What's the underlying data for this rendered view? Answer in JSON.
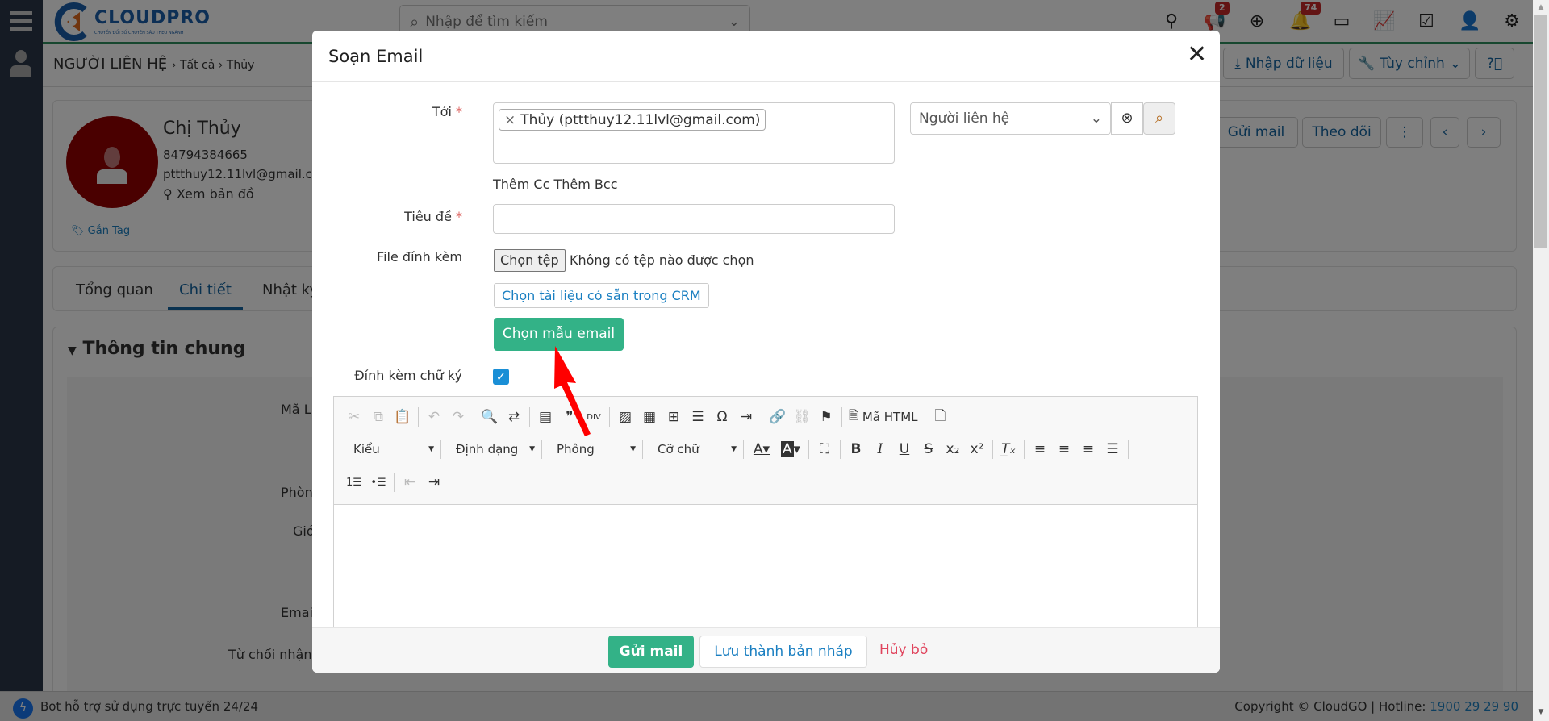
{
  "topbar": {
    "logo_text": "CLOUDPRO",
    "logo_tagline": "CHUYỂN ĐỔI SỐ CHUYÊN SÂU THEO NGÀNH",
    "search_placeholder": "Nhập để tìm kiếm",
    "icons": [
      "location-icon",
      "megaphone-icon",
      "plus-circle-icon",
      "bell-icon",
      "calendar-icon",
      "chart-icon",
      "checkbox-icon",
      "user-icon",
      "gear-icon"
    ],
    "announcement_badge": "2",
    "notification_badge": "74"
  },
  "breadcrumb": {
    "module": "NGƯỜI LIÊN HỆ",
    "filter": "Tất cả",
    "record": "Thủy"
  },
  "header_actions": {
    "import": "Nhập dữ liệu",
    "customize": "Tùy chỉnh"
  },
  "contact": {
    "name": "Chị Thủy",
    "phone": "84794384665",
    "email": "pttthuy12.11lvl@gmail.com",
    "map": "Xem bản đồ",
    "tag": "Gắn Tag",
    "avatar_color": "#950000",
    "actions": {
      "send_mail": "Gửi mail",
      "follow": "Theo dõi"
    }
  },
  "tabs": [
    "Tổng quan",
    "Chi tiết",
    "Nhật ký"
  ],
  "active_tab": "Chi tiết",
  "section": {
    "title": "Thông tin chung",
    "labels": [
      "Mã Li",
      "Phòng",
      "Giớ",
      "Email",
      "Từ chối nhận"
    ]
  },
  "footer": {
    "bot": "Bot hỗ trợ sử dụng trực tuyến 24/24",
    "copyright": "Copyright © CloudGO",
    "hotline_label": "Hotline:",
    "hotline": "1900 29 29 90"
  },
  "modal": {
    "title": "Soạn Email",
    "to_label": "Tới",
    "recipient_tag": "Thủy (pttthuy12.11lvl@gmail.com)",
    "recipient_type": "Người liên hệ",
    "add_cc": "Thêm Cc",
    "add_bcc": "Thêm Bcc",
    "subject_label": "Tiêu đề",
    "subject_value": "",
    "attachment_label": "File đính kèm",
    "choose_file": "Chọn tệp",
    "no_file": "Không có tệp nào được chọn",
    "choose_crm_doc": "Chọn tài liệu có sẵn trong CRM",
    "choose_template": "Chọn mẫu email",
    "signature_label": "Đính kèm chữ ký",
    "signature_checked": true,
    "editor": {
      "source": "Mã HTML",
      "style": "Kiểu",
      "format": "Định dạng",
      "font": "Phông",
      "size": "Cỡ chữ",
      "body": ""
    },
    "send": "Gửi mail",
    "save_draft": "Lưu thành bản nháp",
    "cancel": "Hủy bỏ"
  },
  "colors": {
    "primary_green": "#33b287",
    "link_blue": "#1a7fc1",
    "cancel_red": "#e0435c",
    "checkbox_blue": "#1a8fd6"
  }
}
